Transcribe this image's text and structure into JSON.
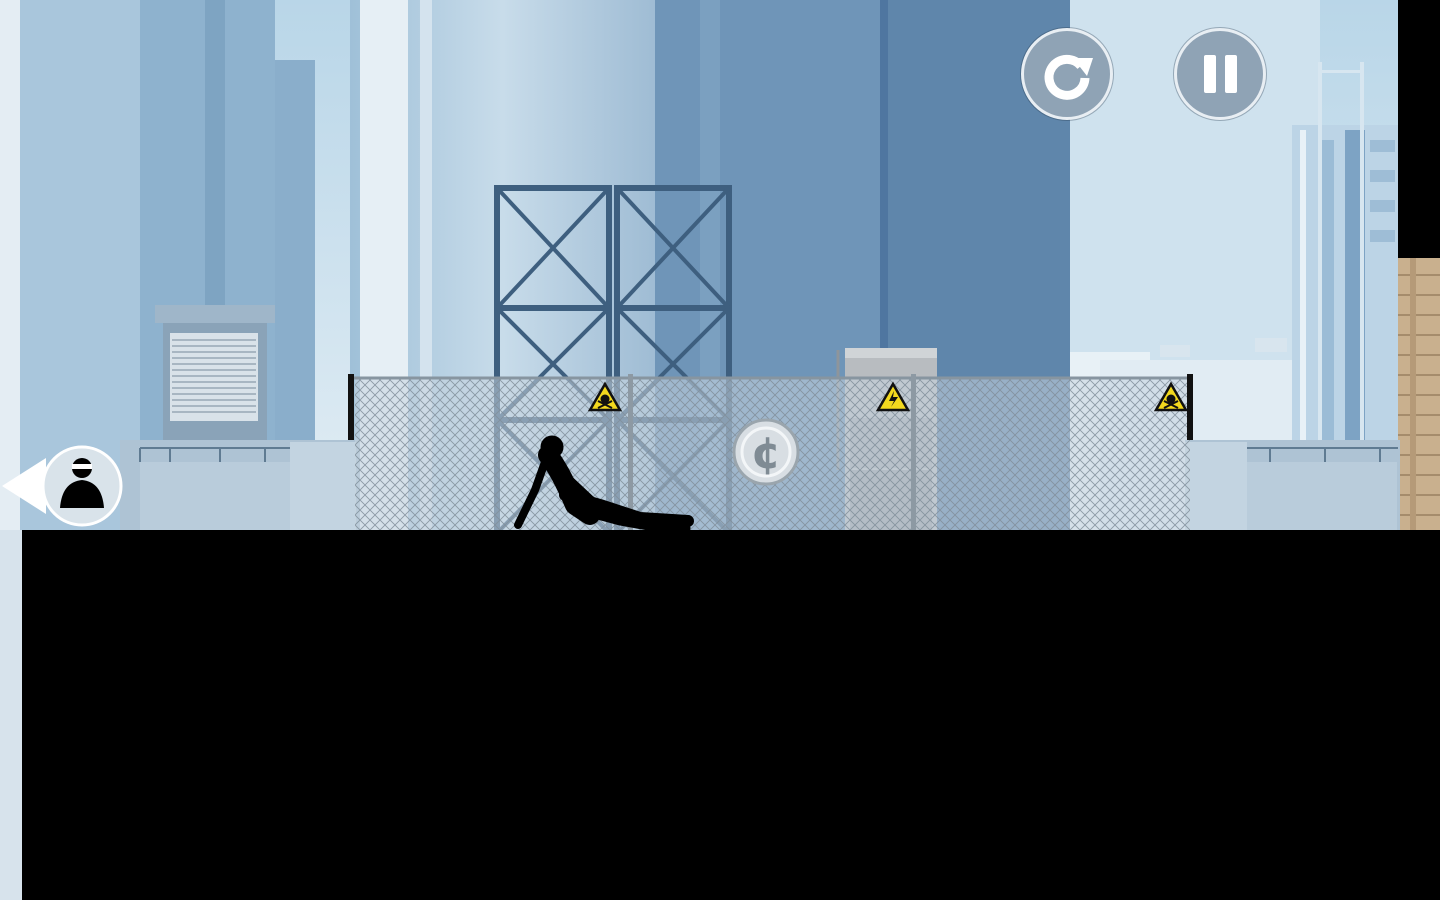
{
  "game": {
    "title": "",
    "hud": {
      "restart_icon": "restart-arrow-icon",
      "pause_icon": "pause-icon",
      "pursuer_icon": "hunter-silhouette-icon"
    },
    "warning_signs": [
      "skull-hazard-icon",
      "high-voltage-icon",
      "skull-hazard-icon"
    ],
    "collectible": {
      "symbol": "¢",
      "name": "coin-icon"
    },
    "player_state": "sliding",
    "colors": {
      "sky": "#cfe3ef",
      "building_light": "#bcd2e2",
      "building_mid": "#8fb0cc",
      "building_dark": "#6c8fb0",
      "ground": "#000000",
      "hud_button": "#8fa3b5"
    }
  }
}
